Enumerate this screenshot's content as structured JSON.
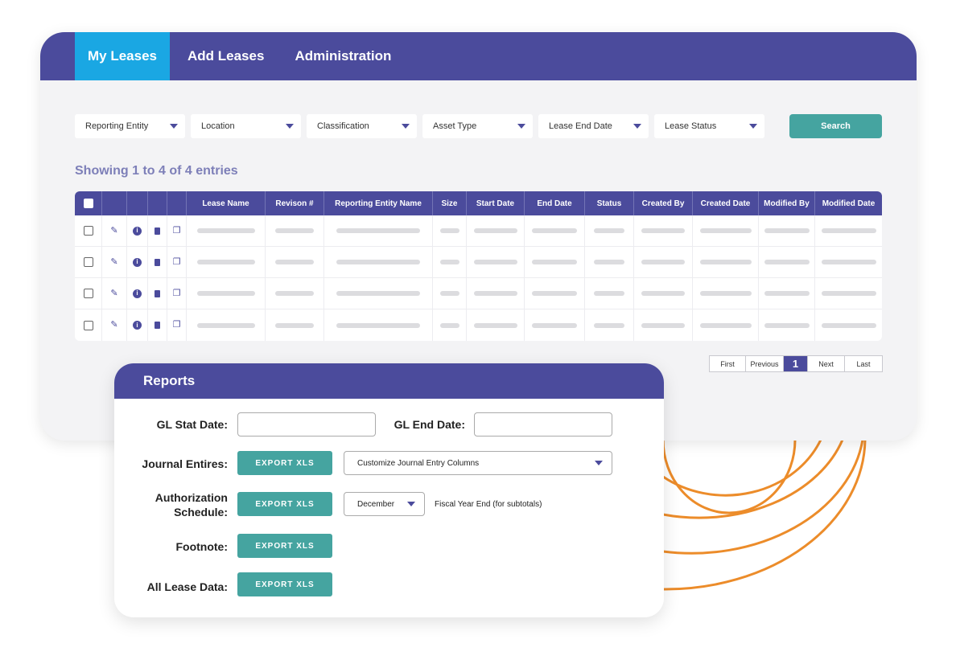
{
  "nav": {
    "tabs": [
      {
        "label": "My Leases",
        "active": true
      },
      {
        "label": "Add Leases",
        "active": false
      },
      {
        "label": "Administration",
        "active": false
      }
    ]
  },
  "filters": [
    "Reporting Entity",
    "Location",
    "Classification",
    "Asset Type",
    "Lease End Date",
    "Lease Status"
  ],
  "search_label": "Search",
  "showing_text": "Showing 1 to 4 of 4 entries",
  "table": {
    "columns": [
      "Lease Name",
      "Revison #",
      "Reporting Entity Name",
      "Size",
      "Start Date",
      "End Date",
      "Status",
      "Created By",
      "Created Date",
      "Modified By",
      "Modified Date"
    ],
    "row_count": 4,
    "row_icons": [
      "pencil-icon",
      "info-icon",
      "trash-icon",
      "copy-icon"
    ]
  },
  "pagination": {
    "first": "First",
    "previous": "Previous",
    "current": "1",
    "next": "Next",
    "last": "Last"
  },
  "reports": {
    "title": "Reports",
    "gl_start_label": "GL Stat Date:",
    "gl_end_label": "GL End Date:",
    "journal_label": "Journal Entires:",
    "journal_select": "Customize Journal Entry Columns",
    "auth_label_line1": "Authorization",
    "auth_label_line2": "Schedule:",
    "month_select": "December",
    "fiscal_note": "Fiscal Year End (for subtotals)",
    "footnote_label": "Footnote:",
    "all_lease_label": "All Lease Data:",
    "export_label": "EXPORT XLS"
  },
  "colors": {
    "primary": "#4b4b9c",
    "active_tab": "#1aa7e3",
    "teal": "#45a4a0",
    "accent_orange": "#ec8c2a",
    "panel_bg": "#f3f3f5"
  }
}
